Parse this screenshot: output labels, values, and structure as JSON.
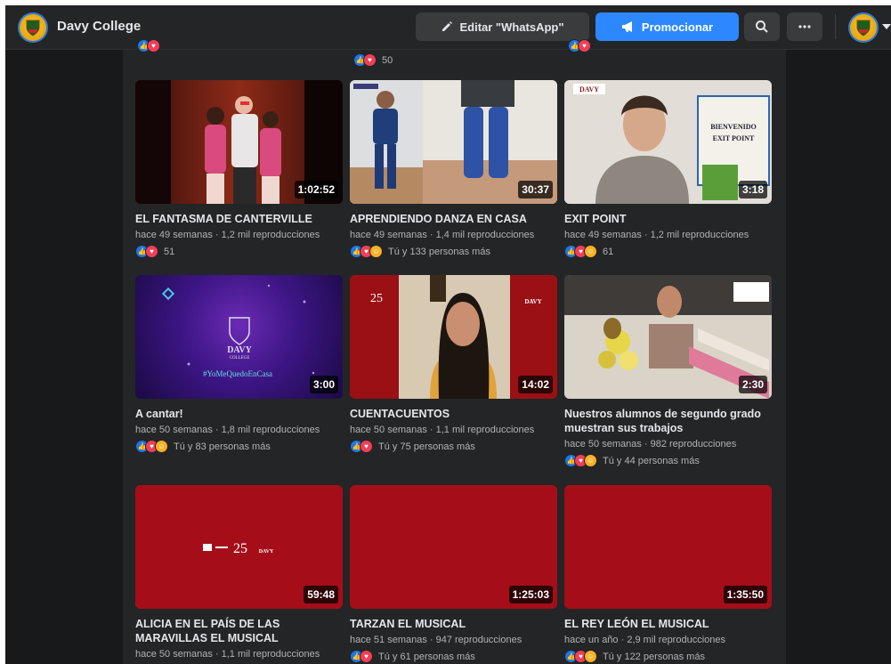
{
  "header": {
    "page_name": "Davy College",
    "edit_label": "Editar \"WhatsApp\"",
    "promote_label": "Promocionar"
  },
  "top_row": {
    "middle_count": "50"
  },
  "videos": [
    {
      "title": "EL FANTASMA DE CANTERVILLE",
      "meta": "hace 49 semanas · 1,2 mil reproducciones",
      "reactions": "51",
      "duration": "1:02:52"
    },
    {
      "title": "APRENDIENDO DANZA EN CASA",
      "meta": "hace 49 semanas · 1,4 mil reproducciones",
      "reactions": "Tú y 133 personas más",
      "duration": "30:37"
    },
    {
      "title": "EXIT POINT",
      "meta": "hace 49 semanas · 1,2 mil reproducciones",
      "reactions": "61",
      "duration": "3:18"
    },
    {
      "title": "A cantar!",
      "meta": "hace 50 semanas · 1,8 mil reproducciones",
      "reactions": "Tú y 83 personas más",
      "duration": "3:00"
    },
    {
      "title": "CUENTACUENTOS",
      "meta": "hace 50 semanas · 1,1 mil reproducciones",
      "reactions": "Tú y 75 personas más",
      "duration": "14:02"
    },
    {
      "title": "Nuestros alumnos de segundo grado muestran sus trabajos",
      "meta": "hace 50 semanas · 982 reproducciones",
      "reactions": "Tú y 44 personas más",
      "duration": "2:30"
    },
    {
      "title": "ALICIA EN EL PAÍS DE LAS MARAVILLAS EL MUSICAL",
      "meta": "hace 50 semanas · 1,1 mil reproducciones",
      "reactions": "",
      "duration": "59:48"
    },
    {
      "title": "TARZAN EL MUSICAL",
      "meta": "hace 51 semanas · 947 reproducciones",
      "reactions": "Tú y 61 personas más",
      "duration": "1:25:03"
    },
    {
      "title": "EL REY LEÓN EL MUSICAL",
      "meta": "hace un año · 2,9 mil reproducciones",
      "reactions": "Tú y 122 personas más",
      "duration": "1:35:50"
    }
  ],
  "thumb_text": {
    "hashtag": "#YoMeQuedoEnCasa",
    "brand": "DAVY",
    "brand_sub": "COLLEGE",
    "anniversary": "25",
    "sign_line1": "BIENVENIDO",
    "sign_line2": "EXIT POINT"
  },
  "colors": {
    "background": "#18191a",
    "panel": "#242526",
    "accent": "#2d88ff",
    "brand_red": "#a50e19"
  }
}
